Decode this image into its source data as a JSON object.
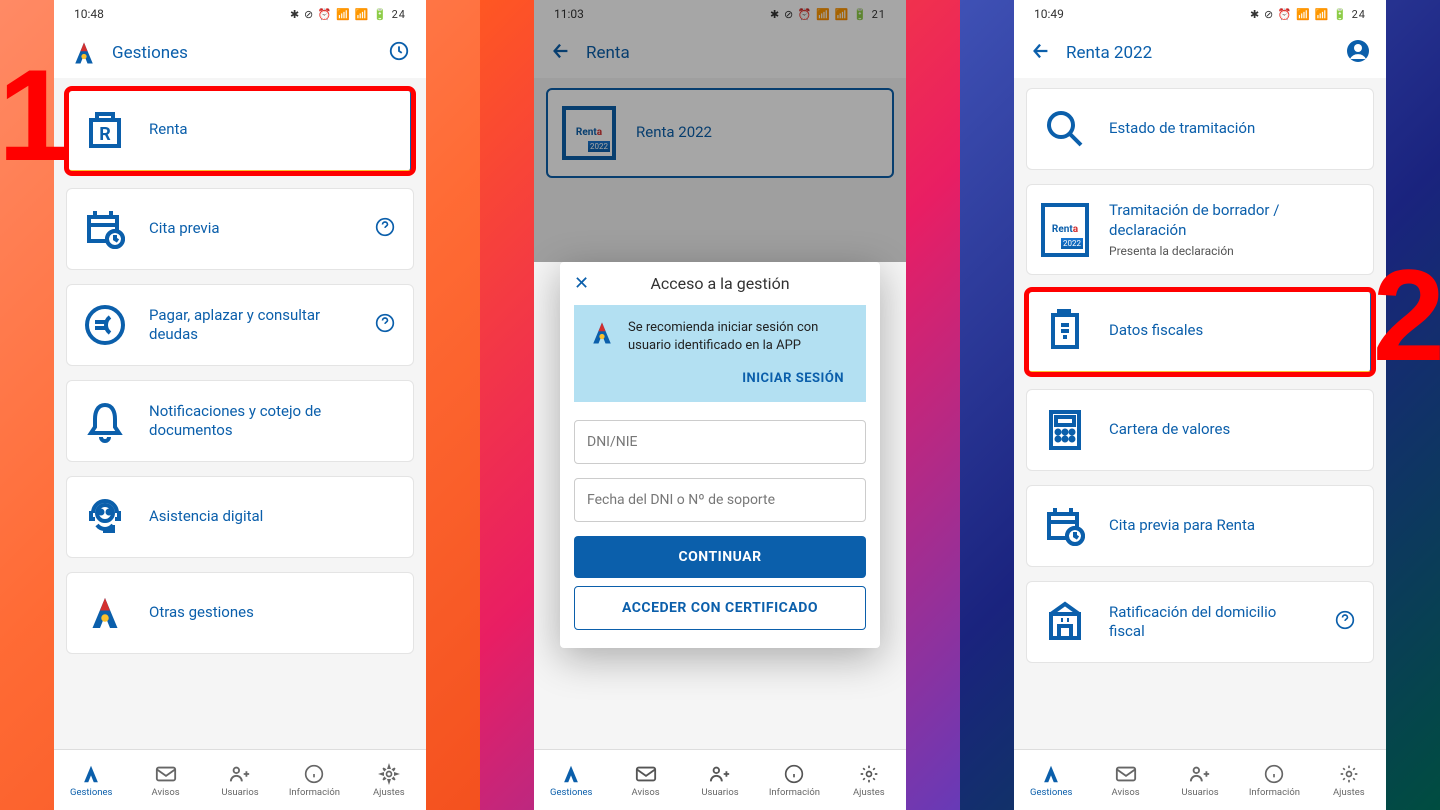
{
  "colors": {
    "primary": "#0b5fab",
    "accent": "#fbc02d",
    "highlight": "#ff0000"
  },
  "steps": {
    "one": "1",
    "two": "2"
  },
  "phone1": {
    "status": {
      "time": "10:48",
      "icons": "✱ ⊘ ⏰ 📶 📶 🔋 24"
    },
    "header": {
      "title": "Gestiones"
    },
    "items": [
      {
        "label": "Renta",
        "highlighted": true
      },
      {
        "label": "Cita previa",
        "help": true
      },
      {
        "label": "Pagar, aplazar y consultar deudas",
        "help": true
      },
      {
        "label": "Notificaciones y cotejo de documentos"
      },
      {
        "label": "Asistencia digital"
      },
      {
        "label": "Otras gestiones"
      }
    ]
  },
  "phone2": {
    "status": {
      "time": "11:03",
      "icons": "✱ ⊘ ⏰ 📶 📶 🔋 21"
    },
    "header": {
      "title": "Renta"
    },
    "bg_item": "Renta 2022",
    "modal": {
      "title": "Acceso a la gestión",
      "info": "Se recomienda iniciar sesión con usuario identificado en la APP",
      "login_action": "INICIAR SESIÓN",
      "field1_placeholder": "DNI/NIE",
      "field2_placeholder": "Fecha del DNI o Nº de soporte",
      "continue": "CONTINUAR",
      "cert": "ACCEDER CON CERTIFICADO"
    }
  },
  "phone3": {
    "status": {
      "time": "10:49",
      "icons": "✱ ⊘ ⏰ 📶 📶 🔋 24"
    },
    "header": {
      "title": "Renta 2022"
    },
    "items": [
      {
        "label": "Estado de tramitación"
      },
      {
        "label": "Tramitación de borrador / declaración",
        "sub": "Presenta la declaración",
        "badge": true
      },
      {
        "label": "Datos fiscales",
        "highlighted": true
      },
      {
        "label": "Cartera de valores"
      },
      {
        "label": "Cita previa para Renta"
      },
      {
        "label": "Ratificación del domicilio fiscal",
        "help": true
      }
    ]
  },
  "nav": {
    "items": [
      {
        "label": "Gestiones"
      },
      {
        "label": "Avisos"
      },
      {
        "label": "Usuarios"
      },
      {
        "label": "Información"
      },
      {
        "label": "Ajustes"
      }
    ]
  }
}
